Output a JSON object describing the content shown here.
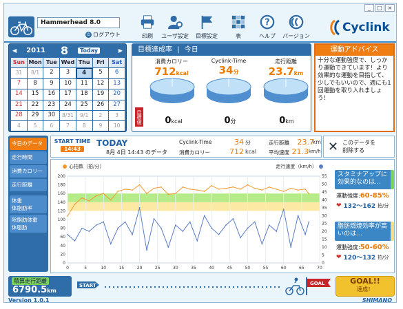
{
  "window": {
    "minimize": "_",
    "maximize": "□",
    "close": "×"
  },
  "user": {
    "name": "Hammerhead 8.0",
    "logout": "ログアウト"
  },
  "toolbar": [
    {
      "label": "印刷",
      "icon": "printer-icon"
    },
    {
      "label": "ユーザ設定",
      "icon": "user-icon"
    },
    {
      "label": "目標設定",
      "icon": "flag-icon"
    },
    {
      "label": "表",
      "icon": "table-icon"
    },
    {
      "label": "ヘルプ",
      "icon": "help-icon"
    },
    {
      "label": "バージョン",
      "icon": "version-icon"
    }
  ],
  "brand": "Cyclink",
  "calendar": {
    "year": "2011",
    "month": "8",
    "today_button": "Today",
    "weekdays": [
      "Sun",
      "Mon",
      "Tue",
      "Wed",
      "Thu",
      "Fri",
      "Sat"
    ],
    "days": [
      "31",
      "8/1",
      "2",
      "3",
      "4",
      "5",
      "6",
      "7",
      "8",
      "9",
      "10",
      "11",
      "12",
      "13",
      "14",
      "15",
      "16",
      "17",
      "18",
      "19",
      "20",
      "21",
      "22",
      "23",
      "24",
      "25",
      "26",
      "27",
      "28",
      "29",
      "30",
      "8/31",
      "9/1",
      "2",
      "3",
      "4",
      "5",
      "6",
      "7",
      "8",
      "9",
      "10"
    ],
    "selected": "4"
  },
  "target": {
    "title": "目標達成率",
    "period": "今日",
    "metrics": [
      {
        "label": "消費カロリー",
        "value": "712",
        "unit": "kcal",
        "remain": "0",
        "remain_unit": "kcal"
      },
      {
        "label": "Cyclink-Time",
        "value": "34",
        "unit": "分",
        "remain": "0",
        "remain_unit": "分"
      },
      {
        "label": "走行距離",
        "value": "23.7",
        "unit": "km",
        "remain": "0",
        "remain_unit": "km"
      }
    ],
    "flag": "目標値"
  },
  "advice": {
    "title": "運動アドバイス",
    "text": "十分な運動強度で、しっかり運動できています！より効果的な運動を目指して、少しでもいいので、週にも1回運動を取り入れましょう！"
  },
  "tabs": [
    "今日のデータ",
    "走行時間",
    "消費カロリー",
    "走行距離",
    "体重\n体脂肪率",
    "除脂肪体重\n体脂肪"
  ],
  "data_bar": {
    "start_label": "START TIME",
    "start_value": "14:43",
    "today": "TODAY",
    "date_text": "8月  4日  14:43  のデータ",
    "cyclink_label": "Cyclink-Time",
    "cyclink_value": "34",
    "cyclink_unit": "分",
    "cal_label": "消費カロリー",
    "cal_value": "712",
    "cal_unit": "kcal",
    "dist_label": "走行距離",
    "dist_value": "23.7",
    "dist_unit": "km",
    "speed_label": "平均速度",
    "speed_value": "21.3",
    "speed_unit": "km/h"
  },
  "delete": {
    "label": "このデータを\n削除する"
  },
  "chart_data": {
    "type": "line",
    "left_axis_label": "心拍数（拍/分）",
    "right_axis_label": "走行速度（km/h）",
    "xlim": [
      0,
      70
    ],
    "x_ticks": [
      0,
      5,
      10,
      15,
      20,
      25,
      30,
      35,
      40,
      45,
      50,
      55,
      60,
      65,
      70
    ],
    "ylim_left": [
      0,
      200
    ],
    "y_ticks_left": [
      0,
      20,
      40,
      60,
      80,
      100,
      120,
      140,
      160,
      180,
      200
    ],
    "ylim_right": [
      0,
      55
    ],
    "y_ticks_right": [
      0,
      5,
      10,
      15,
      20,
      25,
      30,
      35,
      40,
      45,
      50,
      55
    ],
    "bands": [
      {
        "from": 140,
        "to": 160,
        "color": "#b6eb8a"
      },
      {
        "from": 120,
        "to": 140,
        "color": "#fbe9a4"
      }
    ],
    "series": [
      {
        "color": "#f29a2e",
        "axis": "left",
        "x": [
          0,
          2,
          4,
          6,
          8,
          10,
          12,
          14,
          16,
          18,
          20,
          22,
          24,
          26,
          28,
          30,
          32,
          34,
          36,
          38,
          40,
          42,
          44,
          46,
          48,
          50,
          52,
          54,
          56,
          58,
          60,
          62,
          64,
          66,
          67
        ],
        "values": [
          108,
          135,
          150,
          143,
          155,
          160,
          145,
          165,
          170,
          168,
          180,
          160,
          172,
          175,
          158,
          160,
          175,
          170,
          168,
          165,
          178,
          170,
          172,
          175,
          170,
          180,
          172,
          168,
          175,
          170,
          165,
          172,
          168,
          170,
          160
        ]
      },
      {
        "color": "#5a7bc4",
        "axis": "right",
        "x": [
          0,
          2,
          4,
          6,
          8,
          10,
          12,
          14,
          16,
          18,
          20,
          22,
          24,
          26,
          28,
          30,
          32,
          34,
          36,
          38,
          40,
          42,
          44,
          46,
          48,
          50,
          52,
          54,
          56,
          58,
          60,
          62,
          64,
          66,
          67
        ],
        "values": [
          18,
          14,
          22,
          20,
          24,
          26,
          12,
          22,
          26,
          18,
          35,
          8,
          28,
          22,
          10,
          24,
          20,
          26,
          14,
          30,
          22,
          18,
          24,
          28,
          16,
          22,
          26,
          12,
          24,
          20,
          34,
          10,
          30,
          18,
          26
        ]
      }
    ]
  },
  "tips": [
    {
      "title": "スタミナアップに効果的なのは…",
      "intensity_label": "運動強度:",
      "intensity": "60-85",
      "unit": "%",
      "hr": "132〜162",
      "hr_unit": "拍/分"
    },
    {
      "title": "脂肪燃焼効率が高いのは…",
      "intensity_label": "運動強度:",
      "intensity": "50-60",
      "unit": "%",
      "hr": "120〜132",
      "hr_unit": "拍/分"
    }
  ],
  "distance": {
    "label": "積算走行距離",
    "value": "6790.5",
    "unit": "km"
  },
  "progress": {
    "start": "START",
    "goal": "GOAL"
  },
  "goal_box": {
    "title": "GOAL!!",
    "sub": "達成！"
  },
  "footer": {
    "version": "Version 1.0.1",
    "maker": "SHIMANO"
  }
}
